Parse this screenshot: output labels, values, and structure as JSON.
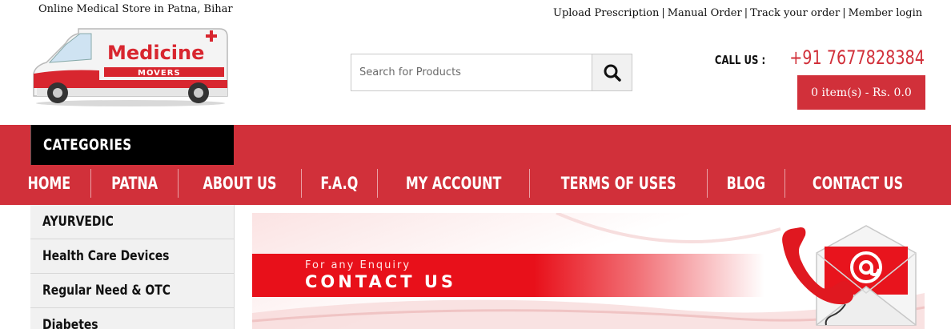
{
  "header": {
    "tagline": "Online Medical Store in Patna, Bihar",
    "top_links": [
      "Upload Prescription",
      "Manual Order",
      "Track your order",
      "Member login"
    ],
    "top_links_separator": "|"
  },
  "logo": {
    "brand_line1": "Medicine",
    "brand_line2": "MOVERS"
  },
  "search": {
    "placeholder": "Search for Products",
    "value": "",
    "button_icon": "search-icon"
  },
  "contact": {
    "label": "CALL US :",
    "phone": "+91 7677828384"
  },
  "cart": {
    "label": "0 item(s) - Rs. 0.0"
  },
  "categories": {
    "header": "CATEGORIES",
    "items": [
      "AYURVEDIC",
      "Health Care Devices",
      "Regular Need & OTC",
      "Diabetes"
    ]
  },
  "nav": {
    "items": [
      "HOME",
      "PATNA",
      "ABOUT US",
      "F.A.Q",
      "MY ACCOUNT",
      "TERMS OF USES",
      "BLOG",
      "CONTACT US"
    ]
  },
  "banner": {
    "subtitle": "For any Enquiry",
    "title": "CONTACT US",
    "icons": [
      "telephone-icon",
      "email-envelope-icon"
    ]
  },
  "colors": {
    "brand_red": "#d1303a",
    "banner_red": "#e8101a",
    "category_header_bg": "#000000",
    "sidebar_bg": "#f1f1f1"
  }
}
